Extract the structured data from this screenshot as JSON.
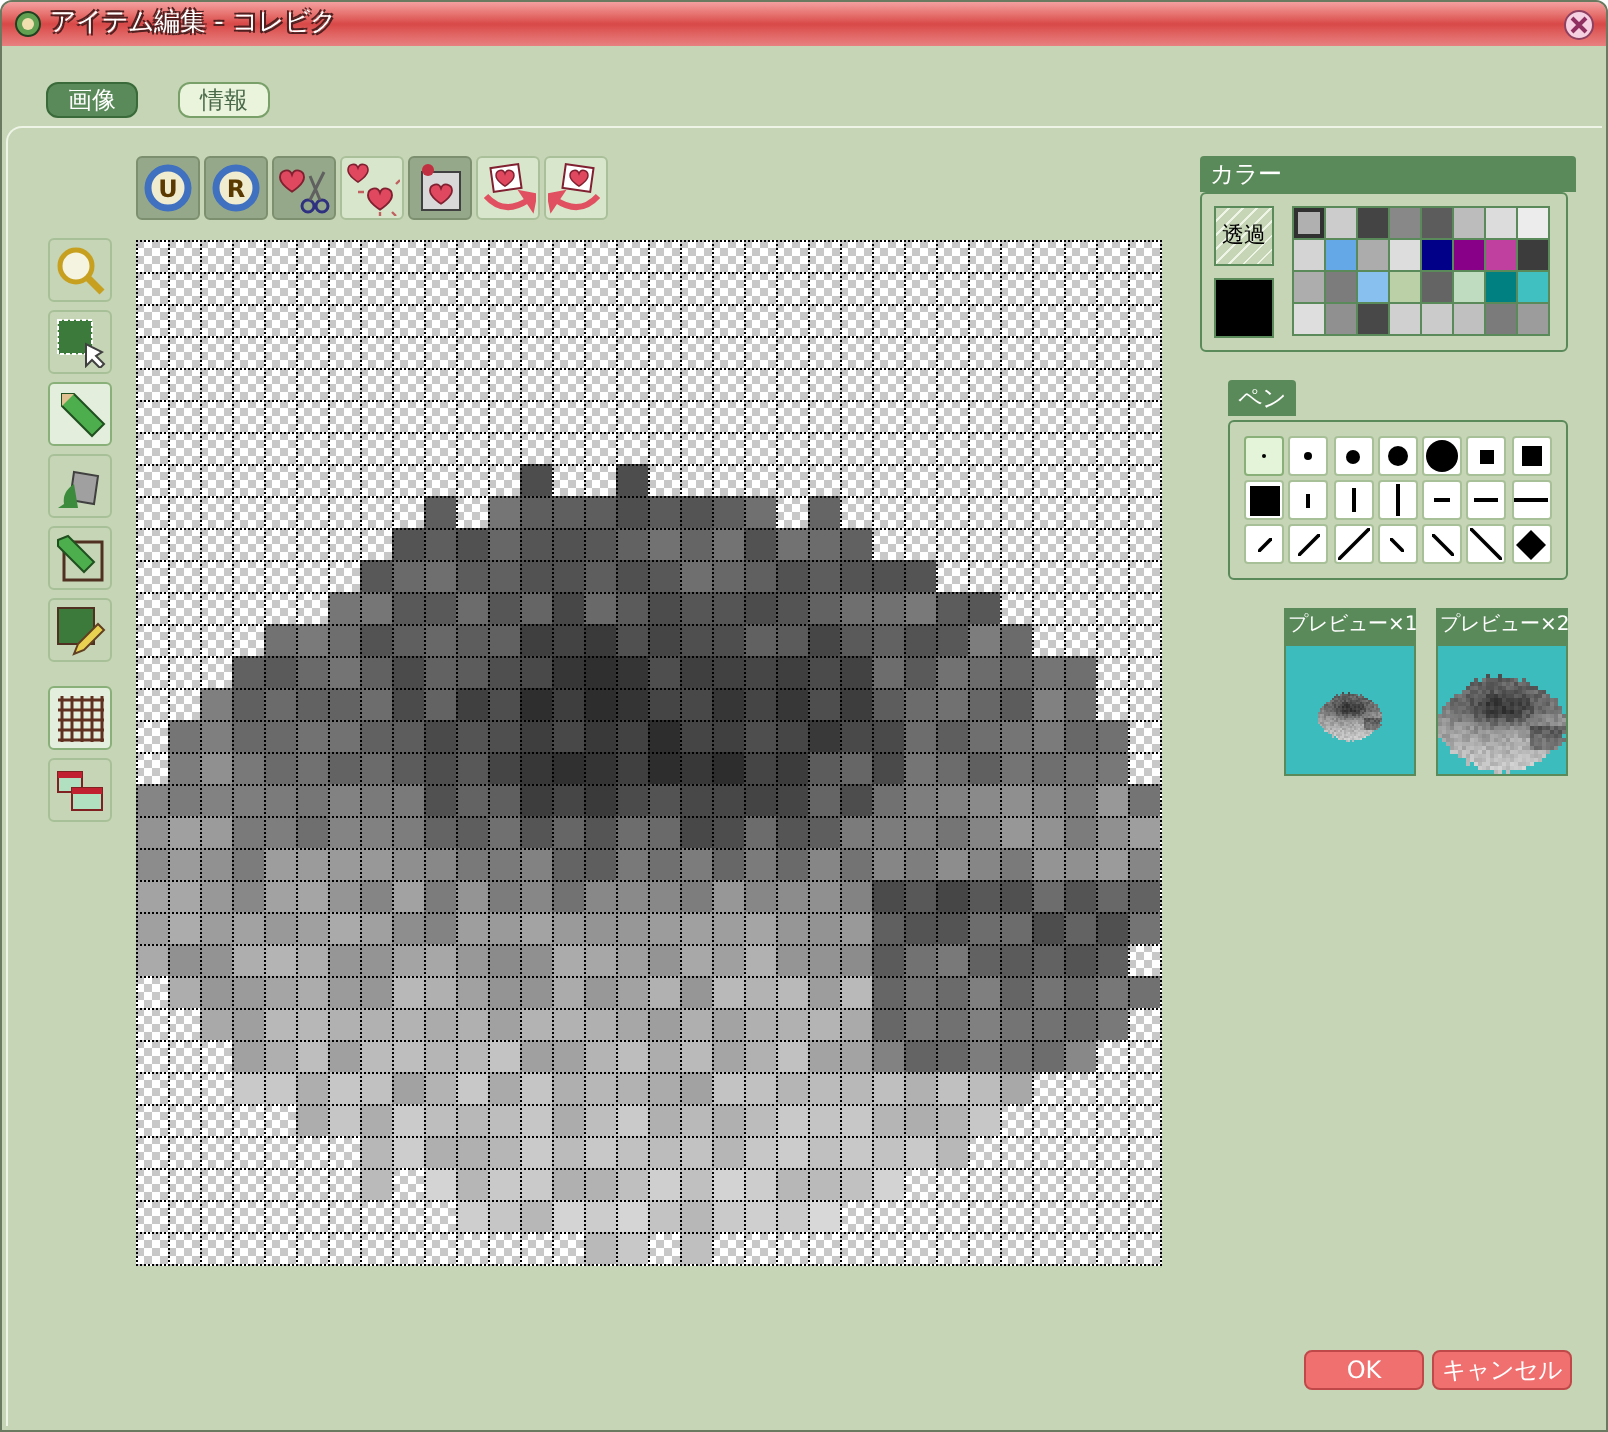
{
  "window": {
    "title": "アイテム編集 - コレビク"
  },
  "tabs": [
    {
      "label": "画像",
      "selected": true
    },
    {
      "label": "情報",
      "selected": false
    }
  ],
  "top_tools": [
    {
      "kind": "undo",
      "label": "U",
      "disabled": true
    },
    {
      "kind": "redo",
      "label": "R",
      "disabled": true
    },
    {
      "kind": "cut",
      "disabled": true
    },
    {
      "kind": "clear",
      "disabled": false
    },
    {
      "kind": "paste",
      "disabled": true
    },
    {
      "kind": "rotateLeft",
      "disabled": false
    },
    {
      "kind": "rotateRight",
      "disabled": false
    }
  ],
  "side_tools": [
    {
      "kind": "zoom",
      "selected": false
    },
    {
      "kind": "select",
      "selected": false
    },
    {
      "kind": "pencil",
      "selected": true
    },
    {
      "kind": "fill",
      "selected": false
    },
    {
      "kind": "pencilBox",
      "selected": false
    },
    {
      "kind": "picker",
      "selected": false
    },
    {
      "kind": "grid",
      "selected": true
    },
    {
      "kind": "layers",
      "selected": false
    }
  ],
  "color_panel": {
    "label": "カラー",
    "transparent_button": "透過",
    "current_swatch": {
      "color": "#000000"
    },
    "swatches": [
      {
        "color": "#b0b0b0",
        "selected": true
      },
      {
        "color": "#cccccc",
        "selected": false
      },
      {
        "color": "#444444",
        "selected": false
      },
      {
        "color": "#888888",
        "selected": false
      },
      {
        "color": "#5c5c5c",
        "selected": false
      },
      {
        "color": "#bcbcbc",
        "selected": false
      },
      {
        "color": "#dcdcdc",
        "selected": false
      },
      {
        "color": "#ececec",
        "selected": false
      },
      {
        "color": "#d4d4d4",
        "selected": false
      },
      {
        "color": "#64a8e8",
        "selected": false
      },
      {
        "color": "#acacac",
        "selected": false
      },
      {
        "color": "#dddddd",
        "selected": false
      },
      {
        "color": "#000088",
        "selected": false
      },
      {
        "color": "#880088",
        "selected": false
      },
      {
        "color": "#c040a0",
        "selected": false
      },
      {
        "color": "#3c3c3c",
        "selected": false
      },
      {
        "color": "#adadad",
        "selected": false
      },
      {
        "color": "#7c7c7c",
        "selected": false
      },
      {
        "color": "#88c0f0",
        "selected": false
      },
      {
        "color": "#bcd0a8",
        "selected": false
      },
      {
        "color": "#646464",
        "selected": false
      },
      {
        "color": "#c0dcc0",
        "selected": false
      },
      {
        "color": "#008080",
        "selected": false
      },
      {
        "color": "#40c0c0",
        "selected": false
      },
      {
        "color": "#dedede",
        "selected": false
      },
      {
        "color": "#909090",
        "selected": false
      },
      {
        "color": "#484848",
        "selected": false
      },
      {
        "color": "#d0d0d0",
        "selected": false
      },
      {
        "color": "#cbcbcb",
        "selected": false
      },
      {
        "color": "#c0c0c0",
        "selected": false
      },
      {
        "color": "#7b7b7b",
        "selected": false
      },
      {
        "color": "#9c9c9c",
        "selected": false
      }
    ]
  },
  "pen_panel": {
    "label": "ペン",
    "pens": [
      {
        "kind": "dot1",
        "selected": true
      },
      {
        "kind": "dot2",
        "selected": false
      },
      {
        "kind": "dot3",
        "selected": false
      },
      {
        "kind": "dot4",
        "selected": false
      },
      {
        "kind": "dot5",
        "selected": false
      },
      {
        "kind": "square2",
        "selected": false
      },
      {
        "kind": "square3",
        "selected": false
      },
      {
        "kind": "square4",
        "selected": false
      },
      {
        "kind": "vline1",
        "selected": false
      },
      {
        "kind": "vline2",
        "selected": false
      },
      {
        "kind": "vline3",
        "selected": false
      },
      {
        "kind": "hline1",
        "selected": false
      },
      {
        "kind": "hline2",
        "selected": false
      },
      {
        "kind": "hline3",
        "selected": false
      },
      {
        "kind": "slash1",
        "selected": false
      },
      {
        "kind": "slash2",
        "selected": false
      },
      {
        "kind": "slash3",
        "selected": false
      },
      {
        "kind": "backslash1",
        "selected": false
      },
      {
        "kind": "backslash2",
        "selected": false
      },
      {
        "kind": "backslash3",
        "selected": false
      },
      {
        "kind": "diamond",
        "selected": false
      }
    ]
  },
  "previews": [
    {
      "label": "プレビュー×1"
    },
    {
      "label": "プレビュー×2"
    }
  ],
  "buttons": [
    {
      "label": "OK"
    },
    {
      "label": "キャンセル"
    }
  ]
}
